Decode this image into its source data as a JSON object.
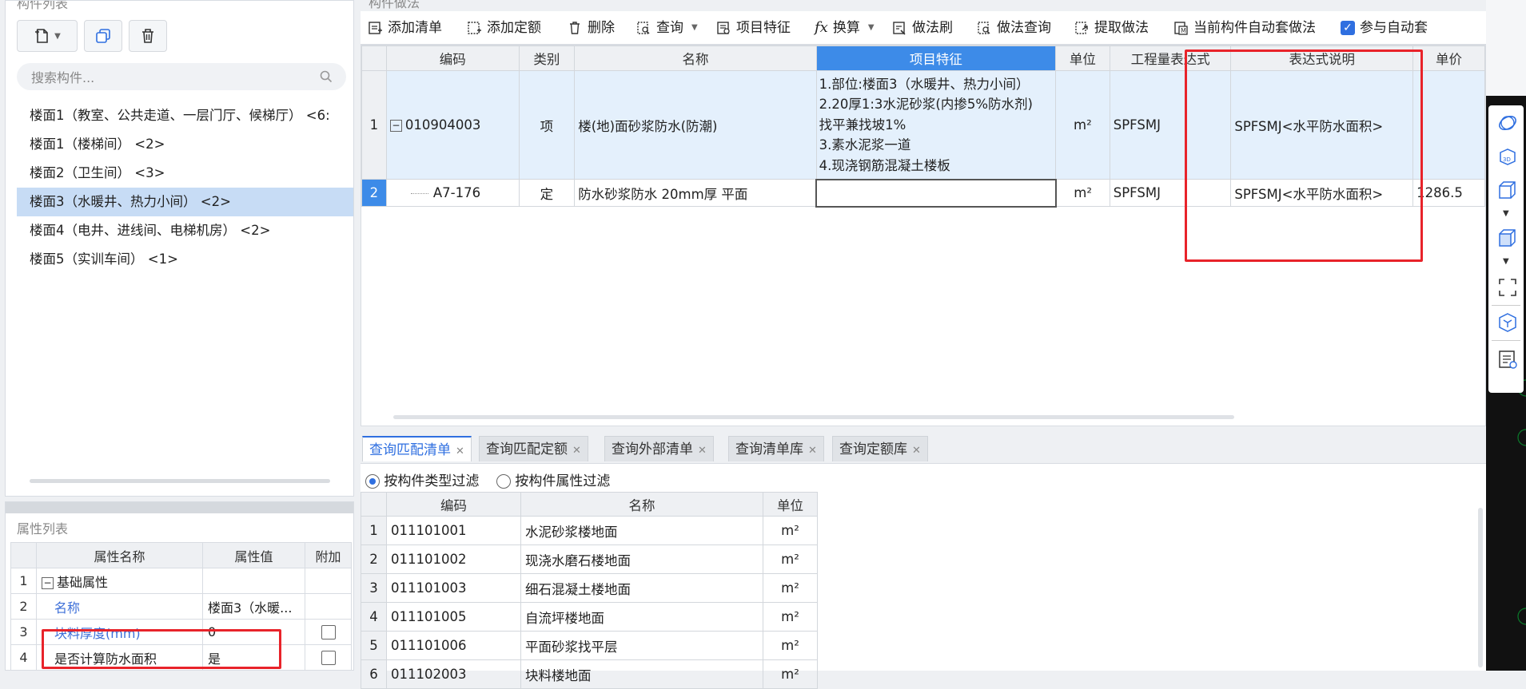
{
  "left_panel": {
    "title": "构件列表",
    "search_placeholder": "搜索构件...",
    "items": [
      {
        "label": "楼面1（教室、公共走道、一层门厅、候梯厅） <6:",
        "selected": false
      },
      {
        "label": "楼面1（楼梯间） <2>",
        "selected": false
      },
      {
        "label": "楼面2（卫生间） <3>",
        "selected": false
      },
      {
        "label": "楼面3（水暖井、热力小间） <2>",
        "selected": true
      },
      {
        "label": "楼面4（电井、进线间、电梯机房） <2>",
        "selected": false
      },
      {
        "label": "楼面5（实训车间） <1>",
        "selected": false
      }
    ]
  },
  "prop_panel": {
    "title": "属性列表",
    "headers": [
      "属性名称",
      "属性值",
      "附加"
    ],
    "rows": [
      {
        "num": "1",
        "name": "基础属性",
        "value": "",
        "group": true
      },
      {
        "num": "2",
        "name": "名称",
        "value": "楼面3（水暖...",
        "blue": true
      },
      {
        "num": "3",
        "name": "块料厚度(mm)",
        "value": "0",
        "blue": true,
        "check": true
      },
      {
        "num": "4",
        "name": "是否计算防水面积",
        "value": "是",
        "check": true
      }
    ]
  },
  "grid_title": "构件做法",
  "toolbar": {
    "add_list": "添加清单",
    "add_quota": "添加定额",
    "delete": "删除",
    "query": "查询",
    "item_feature": "项目特征",
    "convert": "换算",
    "method_brush": "做法刷",
    "method_query": "做法查询",
    "extract_method": "提取做法",
    "auto_apply": "当前构件自动套做法",
    "participate_auto": "参与自动套"
  },
  "grid": {
    "headers": [
      "编码",
      "类别",
      "名称",
      "项目特征",
      "单位",
      "工程量表达式",
      "表达式说明",
      "单价"
    ],
    "rows": [
      {
        "num": "1",
        "code": "010904003",
        "type": "项",
        "name": "楼(地)面砂浆防水(防潮)",
        "feature": "1.部位:楼面3（水暖井、热力小间）\n2.20厚1:3水泥砂浆(内掺5%防水剂)\n找平兼找坡1%\n3.素水泥浆一道\n4.现浇钢筋混凝土楼板",
        "unit": "m²",
        "expr": "SPFSMJ",
        "desc": "SPFSMJ<水平防水面积>",
        "price": ""
      },
      {
        "num": "2",
        "code": "A7-176",
        "type": "定",
        "name": "防水砂浆防水 20mm厚 平面",
        "feature": "",
        "unit": "m²",
        "expr": "SPFSMJ",
        "desc": "SPFSMJ<水平防水面积>",
        "price": "1286.5"
      }
    ]
  },
  "tabs": [
    {
      "label": "查询匹配清单",
      "active": true
    },
    {
      "label": "查询匹配定额",
      "active": false
    },
    {
      "label": "查询外部清单",
      "active": false
    },
    {
      "label": "查询清单库",
      "active": false
    },
    {
      "label": "查询定额库",
      "active": false
    }
  ],
  "filter": {
    "by_type": "按构件类型过滤",
    "by_attr": "按构件属性过滤"
  },
  "bottom_grid": {
    "headers": [
      "编码",
      "名称",
      "单位"
    ],
    "rows": [
      {
        "num": "1",
        "code": "011101001",
        "name": "水泥砂浆楼地面",
        "unit": "m²"
      },
      {
        "num": "2",
        "code": "011101002",
        "name": "现浇水磨石楼地面",
        "unit": "m²"
      },
      {
        "num": "3",
        "code": "011101003",
        "name": "细石混凝土楼地面",
        "unit": "m²"
      },
      {
        "num": "4",
        "code": "011101005",
        "name": "自流坪楼地面",
        "unit": "m²"
      },
      {
        "num": "5",
        "code": "011101006",
        "name": "平面砂浆找平层",
        "unit": "m²"
      },
      {
        "num": "6",
        "code": "011102003",
        "name": "块料楼地面",
        "unit": "m²"
      }
    ]
  },
  "colors": {
    "accent": "#2f6fe0",
    "selection": "#c7dcf5",
    "header_highlight": "#3d8be8",
    "annotation_red": "#e8232a"
  }
}
